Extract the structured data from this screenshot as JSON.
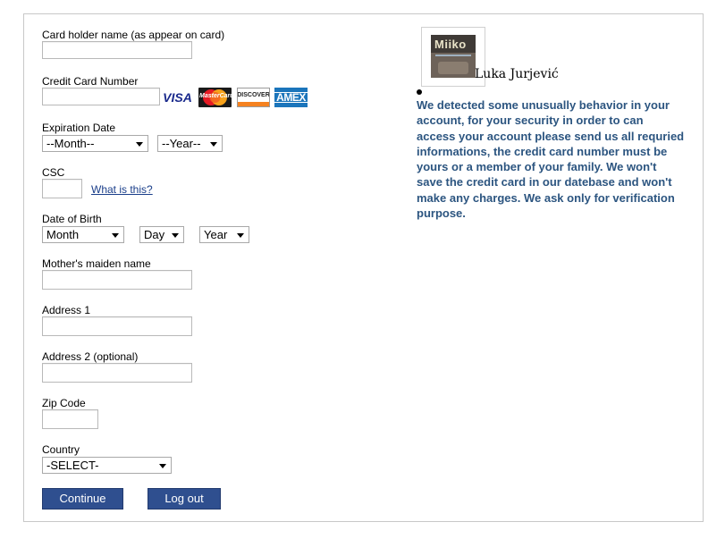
{
  "form": {
    "card_holder_label": "Card holder name (as appear on card)",
    "card_holder_value": "",
    "card_number_label": "Credit Card Number",
    "card_number_value": "",
    "cards": {
      "visa": "VISA",
      "mastercard": "MasterCard",
      "discover": "DISCOVER",
      "amex": "AMEX"
    },
    "expiration_label": "Expiration Date",
    "exp_month": "--Month--",
    "exp_year": "--Year--",
    "csc_label": "CSC",
    "csc_value": "",
    "csc_help_link": "What is this?",
    "dob_label": "Date of Birth",
    "dob_month": "Month",
    "dob_day": "Day",
    "dob_year": "Year",
    "maiden_label": "Mother's maiden name",
    "maiden_value": "",
    "address1_label": "Address 1",
    "address1_value": "",
    "address2_label": "Address 2 (optional)",
    "address2_value": "",
    "zip_label": "Zip Code",
    "zip_value": "",
    "country_label": "Country",
    "country_value": "-SELECT-",
    "continue_label": "Continue",
    "logout_label": "Log out"
  },
  "profile": {
    "logo_text": "Miiko",
    "name": "Luka Jurjević"
  },
  "notice": {
    "text": "We detected some unusually behavior in your account, for your security in order to can access your account please send us all requried informations, the credit card number must be yours or a member of your family. We won't save the credit card in our datebase and won't make any charges. We ask only for verification purpose."
  },
  "colors": {
    "notice_text": "#2c5580",
    "button_bg": "#2f4f8f",
    "link": "#1a3e8a"
  }
}
